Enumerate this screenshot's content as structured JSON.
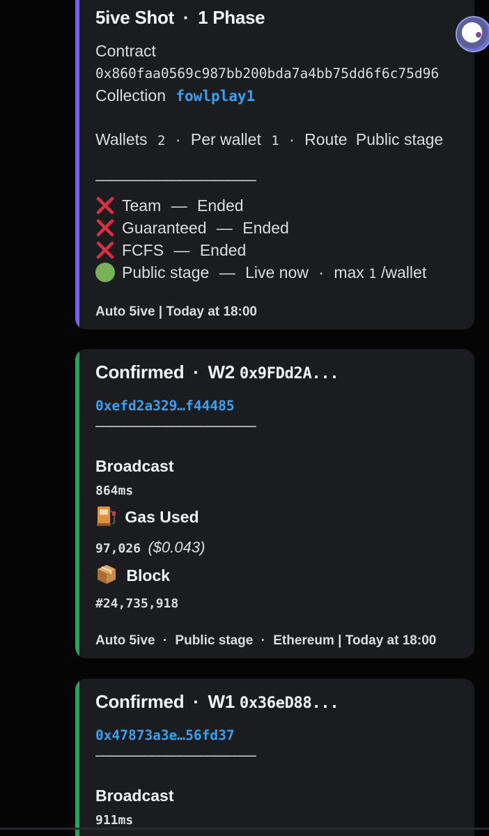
{
  "shot": {
    "title": "5ive Shot",
    "sep": "·",
    "phase": "1 Phase",
    "contract_label": "Contract",
    "contract_address": "0x860faa0569c987bb200bda7a4bb75dd6f6c75d96",
    "collection_label": "Collection",
    "collection_value": "fowlplay1",
    "wallets_label": "Wallets",
    "wallets_value": "2",
    "per_wallet_label": "Per wallet",
    "per_wallet_value": "1",
    "route_label": "Route",
    "route_value": "Public stage",
    "divider": "———————————————————————",
    "stages": [
      {
        "icon": "x-icon",
        "name": "Team",
        "status": "Ended"
      },
      {
        "icon": "x-icon",
        "name": "Guaranteed",
        "status": "Ended"
      },
      {
        "icon": "x-icon",
        "name": "FCFS",
        "status": "Ended"
      }
    ],
    "live_stage": {
      "name": "Public stage",
      "status": "Live now",
      "max_label": "max",
      "max_value": "1",
      "max_suffix": "/wallet"
    },
    "dash": "—",
    "footer": "Auto 5ive | Today at 18:00",
    "accent_color": "#7b5ef0"
  },
  "confirm_w2": {
    "title": "Confirmed",
    "wallet": "W2",
    "wallet_address": "0x9FDd2A...",
    "tx_hash": "0xefd2a329…f44485",
    "divider": "———————————————————————",
    "broadcast_label": "Broadcast",
    "broadcast_value": "864ms",
    "gas_label": "Gas Used",
    "gas_value": "97,026",
    "gas_usd": "($0.043)",
    "block_label": "Block",
    "block_value": "#24,735,918",
    "footer_app": "Auto 5ive",
    "footer_stage": "Public stage",
    "footer_chain": "Ethereum | Today at 18:00",
    "accent_color": "#23a55a"
  },
  "confirm_w1": {
    "title": "Confirmed",
    "wallet": "W1",
    "wallet_address": "0x36eD88...",
    "tx_hash": "0x47873a3e…56fd37",
    "divider": "———————————————————————",
    "broadcast_label": "Broadcast",
    "broadcast_value": "911ms",
    "accent_color": "#23a55a"
  }
}
